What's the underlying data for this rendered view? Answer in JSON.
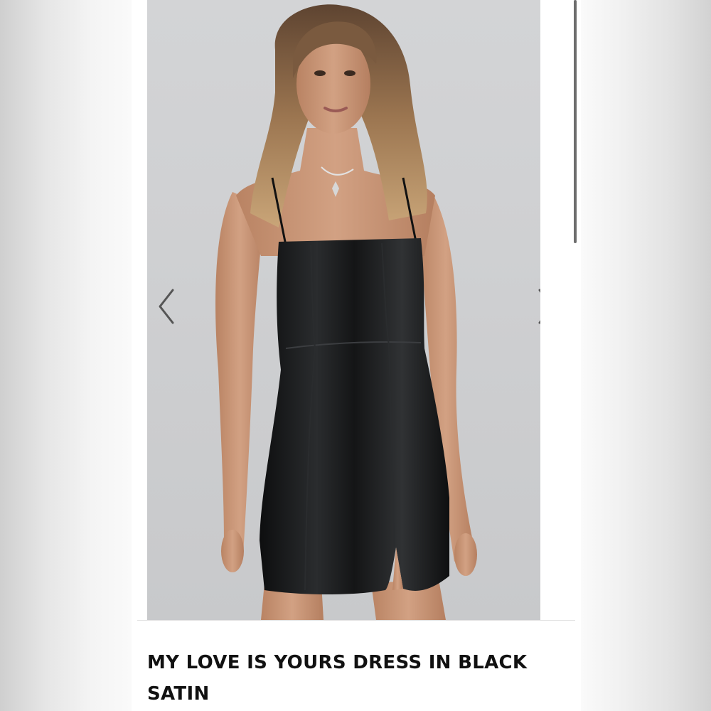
{
  "product": {
    "title": "MY LOVE IS YOURS DRESS IN BLACK SATIN",
    "image_alt": "Model wearing black satin mini dress"
  },
  "gallery": {
    "prev_icon": "chevron-left-icon",
    "next_icon": "chevron-right-icon"
  },
  "colors": {
    "background": "#d9d9d9",
    "page": "#ffffff",
    "title_text": "#111111",
    "dress": "#151617",
    "photo_backdrop": "#cfd0d2"
  }
}
